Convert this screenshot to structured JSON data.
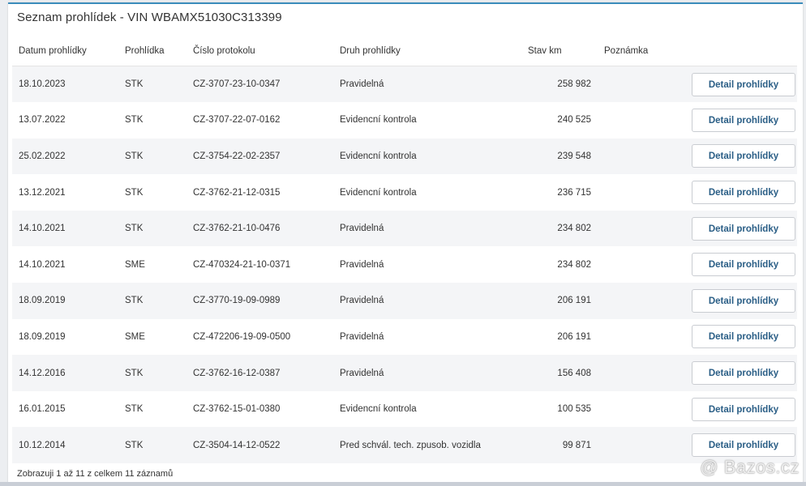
{
  "panel": {
    "title": "Seznam prohlídek - VIN WBAMX51030C313399"
  },
  "table": {
    "headers": {
      "date": "Datum prohlídky",
      "type": "Prohlídka",
      "protocol": "Číslo protokolu",
      "kind": "Druh prohlídky",
      "km": "Stav km",
      "note": "Poznámka"
    },
    "rows": [
      {
        "date": "18.10.2023",
        "type": "STK",
        "protocol": "CZ-3707-23-10-0347",
        "kind": "Pravidelná",
        "km": "258 982",
        "note": "",
        "button": "Detail prohlídky"
      },
      {
        "date": "13.07.2022",
        "type": "STK",
        "protocol": "CZ-3707-22-07-0162",
        "kind": "Evidencní kontrola",
        "km": "240 525",
        "note": "",
        "button": "Detail prohlídky"
      },
      {
        "date": "25.02.2022",
        "type": "STK",
        "protocol": "CZ-3754-22-02-2357",
        "kind": "Evidencní kontrola",
        "km": "239 548",
        "note": "",
        "button": "Detail prohlídky"
      },
      {
        "date": "13.12.2021",
        "type": "STK",
        "protocol": "CZ-3762-21-12-0315",
        "kind": "Evidencní kontrola",
        "km": "236 715",
        "note": "",
        "button": "Detail prohlídky"
      },
      {
        "date": "14.10.2021",
        "type": "STK",
        "protocol": "CZ-3762-21-10-0476",
        "kind": "Pravidelná",
        "km": "234 802",
        "note": "",
        "button": "Detail prohlídky"
      },
      {
        "date": "14.10.2021",
        "type": "SME",
        "protocol": "CZ-470324-21-10-0371",
        "kind": "Pravidelná",
        "km": "234 802",
        "note": "",
        "button": "Detail prohlídky"
      },
      {
        "date": "18.09.2019",
        "type": "STK",
        "protocol": "CZ-3770-19-09-0989",
        "kind": "Pravidelná",
        "km": "206 191",
        "note": "",
        "button": "Detail prohlídky"
      },
      {
        "date": "18.09.2019",
        "type": "SME",
        "protocol": "CZ-472206-19-09-0500",
        "kind": "Pravidelná",
        "km": "206 191",
        "note": "",
        "button": "Detail prohlídky"
      },
      {
        "date": "14.12.2016",
        "type": "STK",
        "protocol": "CZ-3762-16-12-0387",
        "kind": "Pravidelná",
        "km": "156 408",
        "note": "",
        "button": "Detail prohlídky"
      },
      {
        "date": "16.01.2015",
        "type": "STK",
        "protocol": "CZ-3762-15-01-0380",
        "kind": "Evidencní kontrola",
        "km": "100 535",
        "note": "",
        "button": "Detail prohlídky"
      },
      {
        "date": "10.12.2014",
        "type": "STK",
        "protocol": "CZ-3504-14-12-0522",
        "kind": "Pred schvál. tech. zpusob. vozidla",
        "km": "99 871",
        "note": "",
        "button": "Detail prohlídky"
      }
    ]
  },
  "footer": {
    "info": "Zobrazuji 1 až 11 z celkem 11 záznamů"
  },
  "watermark": {
    "text": "@ Bazos.cz"
  },
  "colors": {
    "accent": "#3c8dbc",
    "button_text": "#2a5e86",
    "row_stripe": "#f4f5f7"
  }
}
